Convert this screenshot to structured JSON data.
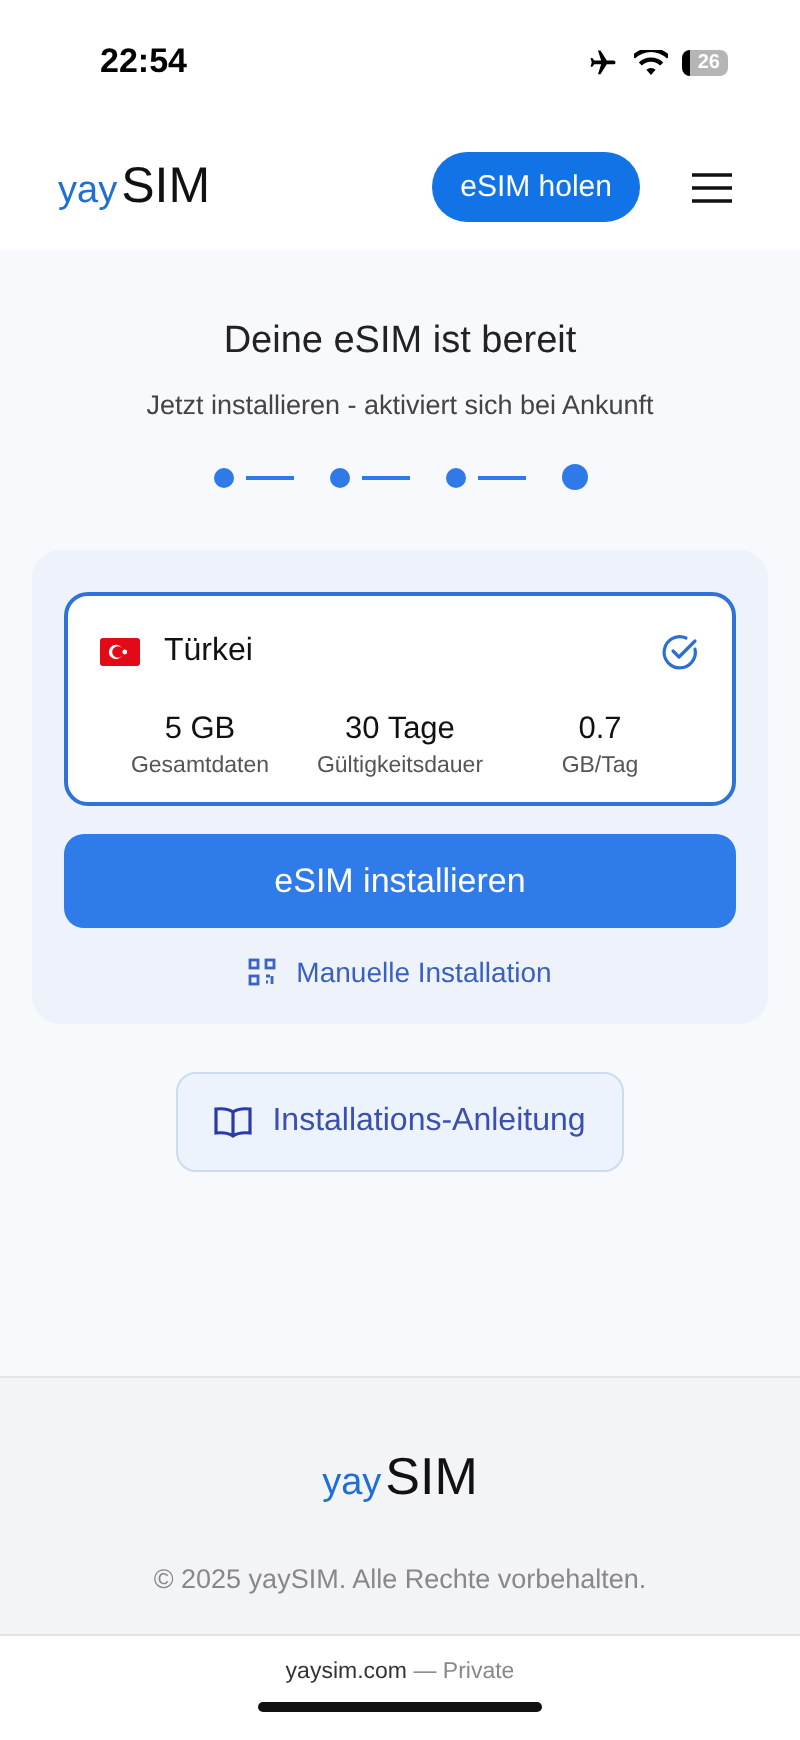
{
  "status_bar": {
    "time": "22:54",
    "battery": "26"
  },
  "header": {
    "logo": {
      "prefix": "yay",
      "name": "SIM"
    },
    "cta": "eSIM holen"
  },
  "title": "Deine eSIM ist bereit",
  "subtitle": "Jetzt installieren - aktiviert sich bei Ankunft",
  "steps": [
    {
      "current": false
    },
    {
      "current": false
    },
    {
      "current": false
    },
    {
      "current": true
    }
  ],
  "plan": {
    "country": "Türkei",
    "selected": true,
    "stats": [
      {
        "value": "5 GB",
        "label": "Gesamtdaten"
      },
      {
        "value": "30 Tage",
        "label": "Gültigkeitsdauer"
      },
      {
        "value": "0.7",
        "label": "GB/Tag"
      }
    ]
  },
  "install_button": "eSIM installieren",
  "manual_link": "Manuelle Installation",
  "guide_button": "Installations-Anleitung",
  "footer": {
    "logo": {
      "prefix": "yay",
      "name": "SIM"
    },
    "copyright": "© 2025 yaySIM. Alle Rechte vorbehalten."
  },
  "browser_bar": {
    "domain": "yaysim.com",
    "mode": "— Private"
  }
}
